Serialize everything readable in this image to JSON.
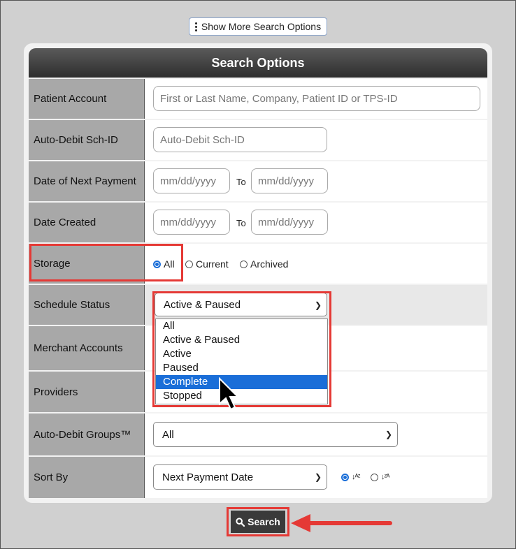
{
  "show_more_label": "Show More Search Options",
  "panel_title": "Search Options",
  "labels": {
    "patient_account": "Patient Account",
    "auto_debit_id": "Auto-Debit Sch-ID",
    "next_payment": "Date of Next Payment",
    "date_created": "Date Created",
    "storage": "Storage",
    "schedule_status": "Schedule Status",
    "merchant_accounts": "Merchant Accounts",
    "providers": "Providers",
    "groups": "Auto-Debit Groups™",
    "sort_by": "Sort By"
  },
  "placeholders": {
    "patient_account": "First or Last Name, Company, Patient ID or TPS-ID",
    "auto_debit_id": "Auto-Debit Sch-ID",
    "date": "mm/dd/yyyy"
  },
  "to_label": "To",
  "storage_options": [
    "All",
    "Current",
    "Archived"
  ],
  "storage_selected": "All",
  "schedule_status": {
    "selected": "Active & Paused",
    "options": [
      "All",
      "Active & Paused",
      "Active",
      "Paused",
      "Complete",
      "Stopped"
    ],
    "highlighted": "Complete"
  },
  "groups_value": "All",
  "sort_by_value": "Next Payment Date",
  "sort_order": {
    "asc_icon": "sort-ascending-icon",
    "desc_icon": "sort-descending-icon",
    "selected": "asc"
  },
  "search_label": "Search",
  "colors": {
    "highlight": "#e53935",
    "accent": "#1a6ed8",
    "header": "#3a3a3a"
  }
}
